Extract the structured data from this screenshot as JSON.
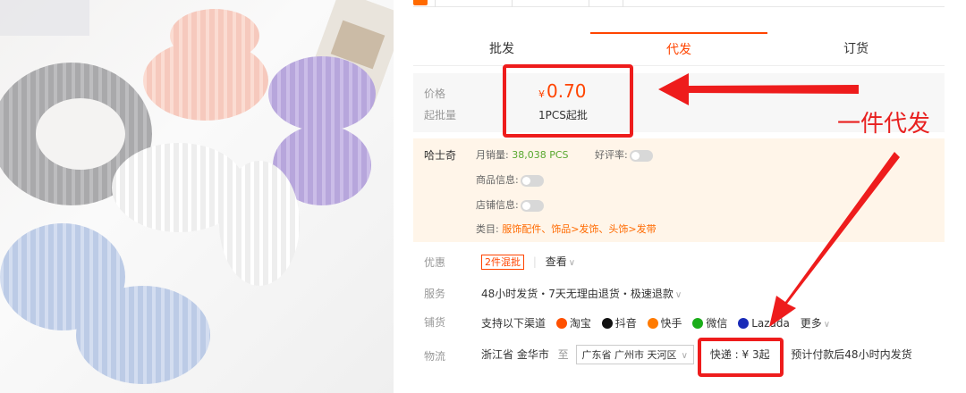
{
  "tabs": [
    {
      "label": "批发",
      "active": false
    },
    {
      "label": "代发",
      "active": true
    },
    {
      "label": "订货",
      "active": false
    }
  ],
  "price": {
    "label": "价格",
    "currency": "¥",
    "value": "0.70",
    "moq_label": "起批量",
    "moq_value": "1PCS起批"
  },
  "shop": {
    "name": "哈士奇",
    "monthly_sales_label": "月销量:",
    "monthly_sales_value": "38,038 PCS",
    "good_rate_label": "好评率:",
    "product_info_label": "商品信息:",
    "store_info_label": "店铺信息:",
    "category_label": "类目:",
    "category_value": "服饰配件、饰品>发饰、头饰>发带"
  },
  "promo": {
    "label": "优惠",
    "tag": "2件混批",
    "view": "查看"
  },
  "service": {
    "label": "服务",
    "value": "48小时发货・7天无理由退货・极速退款"
  },
  "channels": {
    "label": "铺货",
    "intro": "支持以下渠道",
    "items": [
      {
        "name": "淘宝",
        "icon": "taobao-icon",
        "color": "#ff5000"
      },
      {
        "name": "抖音",
        "icon": "douyin-icon",
        "color": "#111111"
      },
      {
        "name": "快手",
        "icon": "kuaishou-icon",
        "color": "#ff7a00"
      },
      {
        "name": "微信",
        "icon": "wechat-icon",
        "color": "#1aad19"
      },
      {
        "name": "Lazada",
        "icon": "lazada-icon",
        "color": "#1a2bb8"
      }
    ],
    "more": "更多"
  },
  "logistics": {
    "label": "物流",
    "from": "浙江省 金华市",
    "to_word": "至",
    "to_select": "广东省 广州市 天河区",
    "express": "快递 : ¥ 3起",
    "note": "预计付款后48小时内发货"
  },
  "annotation": {
    "text": "一件代发",
    "color": "#e8201f"
  },
  "colors": {
    "accent": "#ff4400",
    "shop_bg": "#fff5e9",
    "annotation_red": "#ee1c1c"
  }
}
